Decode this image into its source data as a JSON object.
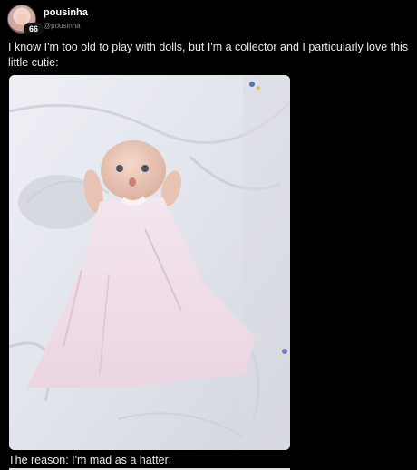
{
  "user": {
    "display_name": "pousinha",
    "handle": "@pousinha",
    "badge_count": "66"
  },
  "post": {
    "text": "I know I'm too old to play with dolls, but I'm a collector and I particularly love this little cutie:",
    "second_text": "The reason: I'm mad as a hatter:"
  },
  "colors": {
    "background": "#000000",
    "text": "#e7e9ea",
    "muted": "#8b8b8b"
  }
}
